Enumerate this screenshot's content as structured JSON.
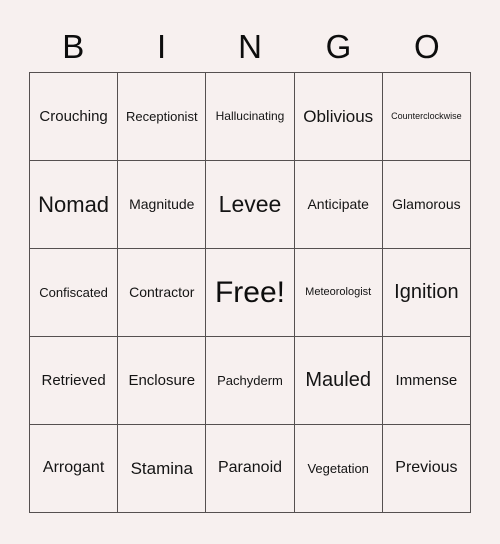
{
  "card": {
    "header_letters": [
      "B",
      "I",
      "N",
      "G",
      "O"
    ],
    "background_color": "#f7f0ef",
    "grid_line_color": "#555050",
    "text_color": "#141414",
    "rows": [
      [
        {
          "label": "Crouching",
          "font_size": 15
        },
        {
          "label": "Receptionist",
          "font_size": 13
        },
        {
          "label": "Hallucinating",
          "font_size": 12
        },
        {
          "label": "Oblivious",
          "font_size": 17
        },
        {
          "label": "Counterclockwise",
          "font_size": 9
        }
      ],
      [
        {
          "label": "Nomad",
          "font_size": 22
        },
        {
          "label": "Magnitude",
          "font_size": 14
        },
        {
          "label": "Levee",
          "font_size": 23
        },
        {
          "label": "Anticipate",
          "font_size": 14
        },
        {
          "label": "Glamorous",
          "font_size": 14
        }
      ],
      [
        {
          "label": "Confiscated",
          "font_size": 13
        },
        {
          "label": "Contractor",
          "font_size": 14
        },
        {
          "label": "Free!",
          "font_size": 30
        },
        {
          "label": "Meteorologist",
          "font_size": 11
        },
        {
          "label": "Ignition",
          "font_size": 20
        }
      ],
      [
        {
          "label": "Retrieved",
          "font_size": 15
        },
        {
          "label": "Enclosure",
          "font_size": 15
        },
        {
          "label": "Pachyderm",
          "font_size": 13
        },
        {
          "label": "Mauled",
          "font_size": 20
        },
        {
          "label": "Immense",
          "font_size": 15
        }
      ],
      [
        {
          "label": "Arrogant",
          "font_size": 16
        },
        {
          "label": "Stamina",
          "font_size": 17
        },
        {
          "label": "Paranoid",
          "font_size": 16
        },
        {
          "label": "Vegetation",
          "font_size": 13
        },
        {
          "label": "Previous",
          "font_size": 16
        }
      ]
    ]
  }
}
